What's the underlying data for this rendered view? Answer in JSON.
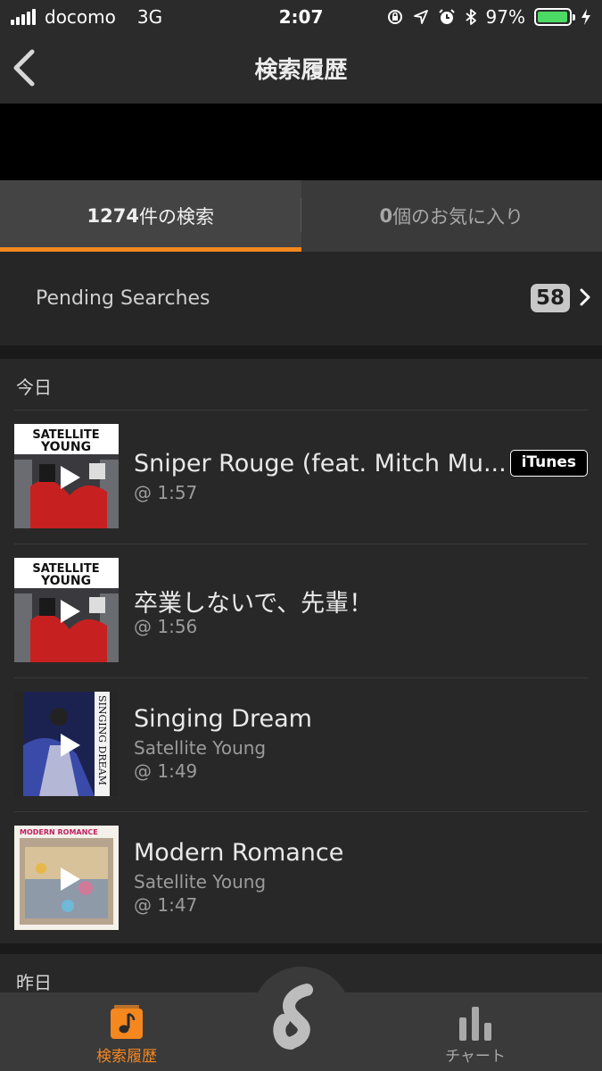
{
  "status": {
    "carrier": "docomo",
    "network": "3G",
    "time": "2:07",
    "battery_percent": "97%",
    "battery_level": 0.97,
    "battery_color": "#4cd964"
  },
  "nav": {
    "title": "検索履歴"
  },
  "tabs": [
    {
      "count": "1274",
      "label": "件の検索",
      "active": true
    },
    {
      "count": "0",
      "label": "個のお気に入り",
      "active": false
    }
  ],
  "pending": {
    "label": "Pending Searches",
    "count": "58"
  },
  "sections": [
    {
      "header": "今日",
      "items": [
        {
          "title": "Sniper Rouge (feat. Mitch Mu...",
          "artist": "",
          "time": "@ 1:57",
          "store": "iTunes",
          "art": "satellite-young"
        },
        {
          "title": "卒業しないで、先輩！",
          "artist": "",
          "time": "@ 1:56",
          "store": "",
          "art": "satellite-young"
        },
        {
          "title": "Singing Dream",
          "artist": "Satellite Young",
          "time": "@ 1:49",
          "store": "",
          "art": "singing-dream"
        },
        {
          "title": "Modern Romance",
          "artist": "Satellite Young",
          "time": "@ 1:47",
          "store": "",
          "art": "modern-romance"
        }
      ]
    },
    {
      "header": "昨日",
      "items": []
    }
  ],
  "album_art_text": {
    "satellite_young_line1": "SATELLITE",
    "satellite_young_line2": "YOUNG",
    "singing_dream_spine": "SINGING DREAM",
    "modern_romance_top": "MODERN ROMANCE"
  },
  "tab_bar": {
    "history_label": "検索履歴",
    "charts_label": "チャート"
  },
  "colors": {
    "accent": "#f5871f",
    "background": "#262626"
  }
}
